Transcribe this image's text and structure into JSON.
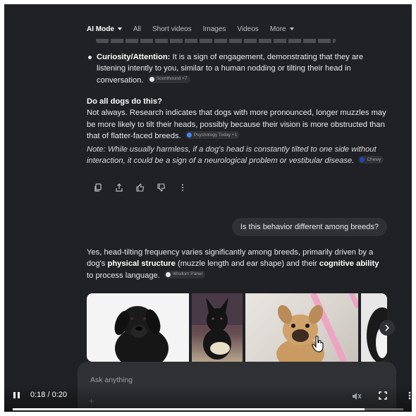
{
  "tabs": [
    {
      "label": "AI Mode",
      "active": true,
      "has_caret": true
    },
    {
      "label": "All"
    },
    {
      "label": "Short videos"
    },
    {
      "label": "Images"
    },
    {
      "label": "Videos"
    },
    {
      "label": "More",
      "has_caret": true
    }
  ],
  "bullet": {
    "term": "Curiosity/Attention:",
    "text": " It is a sign of engagement, demonstrating that they are listening intently to you, similar to a human nodding or tilting their head in conversation.",
    "source": "Scenthound +7"
  },
  "section": {
    "heading": "Do all dogs do this?",
    "text": "Not always. Research indicates that dogs with more pronounced, longer muzzles may be more likely to tilt their heads, possibly because their vision is more obstructed than that of flatter-faced breeds.",
    "source": "Psychology Today +1"
  },
  "note": {
    "text": "Note: While usually harmless, if a dog's head is constantly tilted to one side without interaction, it could be a sign of a neurological problem or vestibular disease.",
    "source": "Chewy"
  },
  "user_query": "Is this behavior different among breeds?",
  "answer": {
    "part1": "Yes, head-tilting frequency varies significantly among breeds, primarily driven by a dog's ",
    "bold1": "physical structure",
    "part2": " (muzzle length and ear shape) and their ",
    "bold2": "cognitive ability",
    "part3": " to process language.",
    "source": "Wisdom Panel"
  },
  "ask": {
    "placeholder": "Ask anything"
  },
  "video": {
    "time": "0:18 / 0:20",
    "progress": 0.9
  },
  "colors": {
    "background": "#202124",
    "surface": "#303134",
    "text": "#e8eaed",
    "muted": "#9aa0a6"
  }
}
